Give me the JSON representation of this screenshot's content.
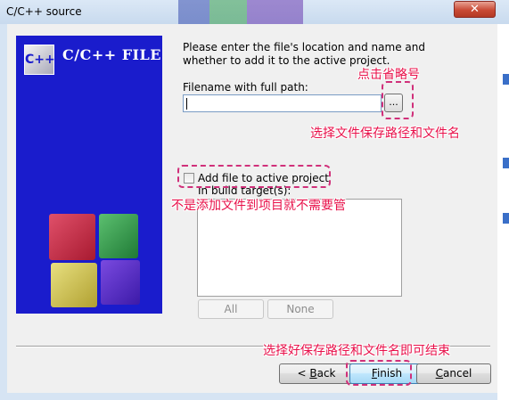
{
  "window": {
    "title": "C/C++ source",
    "close_glyph": "✕"
  },
  "banner": {
    "logo_text": "C++",
    "title": "C/C++ FILE"
  },
  "form": {
    "intro_line1": "Please enter the file's location and name and",
    "intro_line2": "whether to add it to the active project.",
    "filename_label": "Filename with full path:",
    "filename_value": "",
    "browse_label": "...",
    "add_to_project_label": "Add file to active project",
    "add_to_project_checked": false,
    "build_targets_label": "In build target(s):",
    "build_targets_items": [],
    "all_button": "All",
    "none_button": "None"
  },
  "footer": {
    "back_prefix": "< ",
    "back_mnemonic": "B",
    "back_rest": "ack",
    "finish_mnemonic": "F",
    "finish_rest": "inish",
    "cancel_mnemonic": "C",
    "cancel_rest": "ancel"
  },
  "annotations": {
    "click_ellipsis": "点击省略号",
    "choose_path": "选择文件保存路径和文件名",
    "not_adding": "不是添加文件到项目就不需要管",
    "finish_hint": "选择好保存路径和文件名即可结束"
  },
  "colors": {
    "annotation_text": "#e8104a",
    "annotation_border": "#d0307a",
    "banner_bg": "#1a1ccc"
  },
  "icons": [
    "c-plus-plus-logo-icon",
    "color-cubes-icon",
    "close-icon"
  ]
}
